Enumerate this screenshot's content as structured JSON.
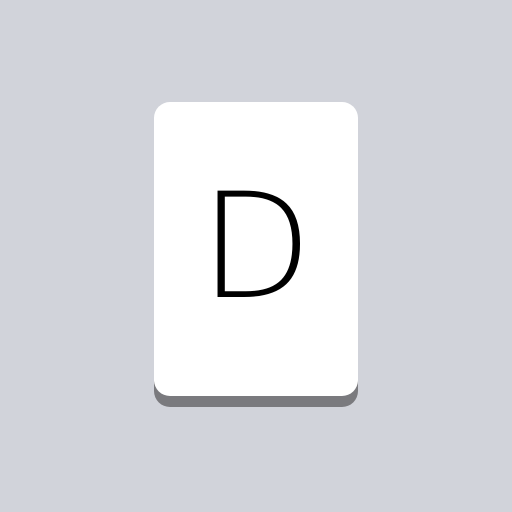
{
  "key": {
    "label": "D"
  },
  "colors": {
    "background": "#d1d3da",
    "key_face": "#ffffff",
    "key_shadow": "#7a7a7e",
    "label": "#000000"
  }
}
